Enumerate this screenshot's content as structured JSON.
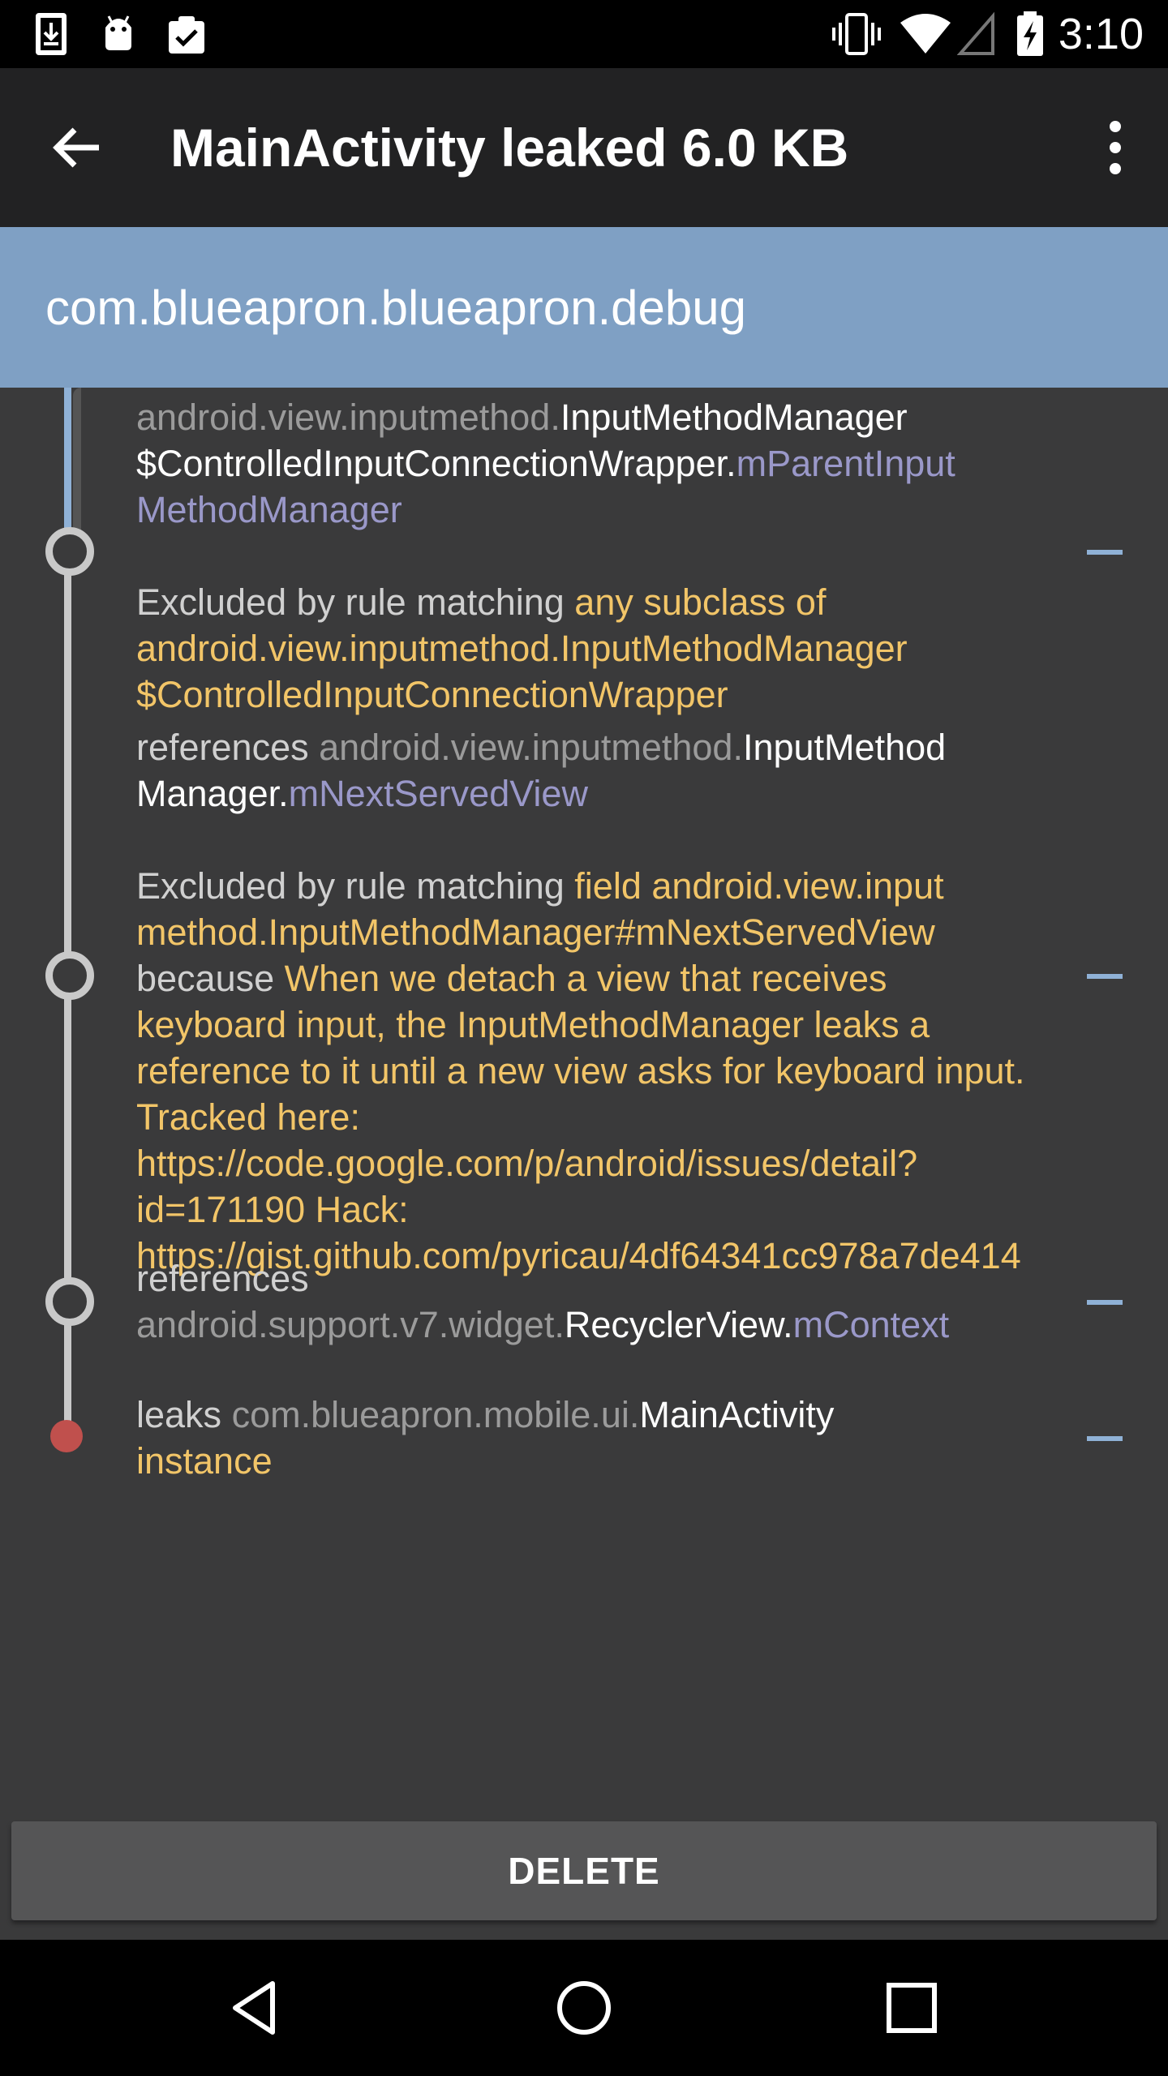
{
  "status_bar": {
    "time": "3:10",
    "left_icons": [
      "download-icon",
      "android-icon",
      "clipboard-check-icon"
    ],
    "right_icons": [
      "vibrate-icon",
      "wifi-icon",
      "signal-icon",
      "battery-charging-icon"
    ]
  },
  "app_bar": {
    "title": "MainActivity leaked 6.0 KB",
    "back_icon": "arrow-back-icon",
    "menu_icon": "more-vert-icon"
  },
  "header": {
    "package_name": "com.blueapron.blueapron.debug"
  },
  "trace": {
    "e1": {
      "pkg": "android.view.inputmethod.",
      "cls": "InputMethodManager",
      "cls2": "$ControlledInputConnectionWrapper.",
      "field": "mParentInput MethodManager"
    },
    "e2": {
      "prefix": "Excluded by rule matching ",
      "rule": "any subclass of android.view.inputmethod.InputMethodManager $ControlledInputConnectionWrapper",
      "ref_word": "references ",
      "pkg": "android.view.inputmethod.",
      "cls": "InputMethod Manager.",
      "field": "mNextServedView"
    },
    "e3": {
      "prefix": "Excluded by rule matching ",
      "rule": "field android.view.input method.InputMethodManager#mNextServedView",
      "because_word": " because ",
      "reason": "When we detach a view that receives keyboard input, the InputMethodManager leaks a reference to it until a new view asks for keyboard input. Tracked here: https://code.google.com/p/android/issues/detail?id=171190 Hack: https://gist.github.com/pyricau/4df64341cc978a7de414"
    },
    "e4": {
      "ref_word": "references",
      "pkg": "android.support.v7.widget.",
      "cls": "RecyclerView.",
      "field": "mContext"
    },
    "e5": {
      "leaks_word": "leaks ",
      "pkg": "com.blueapron.mobile.ui.",
      "cls": "MainActivity",
      "instance_word": "instance"
    }
  },
  "delete_button": {
    "label": "DELETE"
  },
  "nav_bar": {
    "icons": [
      "back-triangle-icon",
      "home-circle-icon",
      "recents-square-icon"
    ]
  },
  "colors": {
    "app_bar": "#222223",
    "header": "#7fa0c4",
    "background": "#3a3a3b",
    "highlight_yellow": "#f2c568",
    "field_purple": "#9a98c9",
    "leak_red": "#c0504d"
  }
}
